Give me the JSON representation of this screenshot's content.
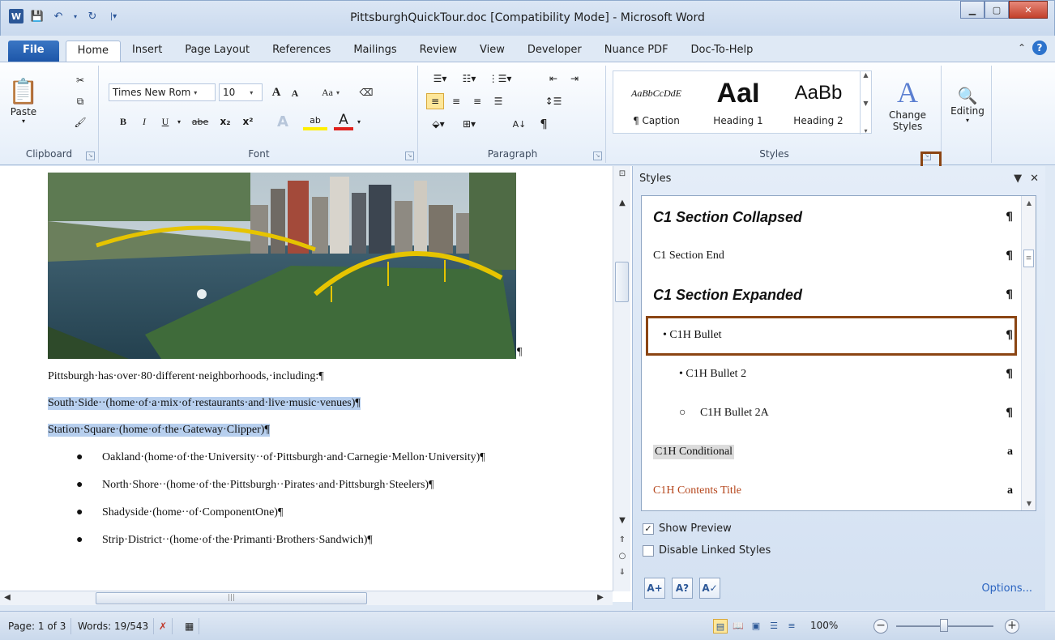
{
  "window": {
    "title": "PittsburghQuickTour.doc [Compatibility Mode] - Microsoft Word",
    "app_icon": "W",
    "controls": [
      "minimize",
      "maximize",
      "close"
    ]
  },
  "tabs": [
    "File",
    "Home",
    "Insert",
    "Page Layout",
    "References",
    "Mailings",
    "Review",
    "View",
    "Developer",
    "Nuance PDF",
    "Doc-To-Help"
  ],
  "active_tab": "Home",
  "ribbon": {
    "clipboard": {
      "label": "Clipboard",
      "paste_label": "Paste"
    },
    "font": {
      "label": "Font",
      "font_name": "Times New Rom",
      "font_size": "10",
      "aa_label": "Aa",
      "bold": "B",
      "italic": "I",
      "underline": "U",
      "strike": "abe",
      "subscript": "x₂",
      "superscript": "x²",
      "grow": "A",
      "shrink": "A",
      "highlight": "ab",
      "fontcolor": "A",
      "effects": "A"
    },
    "paragraph": {
      "label": "Paragraph",
      "pilcrow": "¶",
      "sort": "A↓"
    },
    "styles": {
      "label": "Styles",
      "gallery": [
        {
          "preview": "AaBbCcDdE",
          "name": "¶ Caption"
        },
        {
          "preview": "AaI",
          "name": "Heading 1"
        },
        {
          "preview": "AaBb",
          "name": "Heading 2"
        }
      ],
      "change_styles_line1": "Change",
      "change_styles_line2": "Styles"
    },
    "editing": {
      "label": "Editing"
    }
  },
  "document": {
    "intro": "Pittsburgh·has·over·80·different·neighborhoods,·including:¶",
    "selected_lines": [
      "South·Side··(home·of·a·mix·of·restaurants·and·live·music·venues)¶",
      "Station·Square·(home·of·the·Gateway·Clipper)¶"
    ],
    "bullets": [
      "Oakland·(home·of·the·University··of·Pittsburgh·and·Carnegie·Mellon·University)¶",
      "North·Shore··(home·of·the·Pittsburgh··Pirates·and·Pittsburgh·Steelers)¶",
      "Shadyside·(home··of·ComponentOne)¶",
      "Strip·District··(home·of·the·Primanti·Brothers·Sandwich)¶"
    ],
    "image_pilcrow": "¶"
  },
  "styles_pane": {
    "title": "Styles",
    "items": [
      {
        "name": "C1 Section Collapsed",
        "mark": "¶",
        "kind": "heading"
      },
      {
        "name": "C1 Section End",
        "mark": "¶",
        "kind": "normal"
      },
      {
        "name": "C1 Section Expanded",
        "mark": "¶",
        "kind": "heading"
      },
      {
        "name": "• C1H Bullet",
        "mark": "¶",
        "kind": "normal"
      },
      {
        "name": "• C1H Bullet 2",
        "mark": "¶",
        "kind": "normal"
      },
      {
        "name": "○     C1H Bullet 2A",
        "mark": "¶",
        "kind": "normal"
      },
      {
        "name": "C1H Conditional",
        "mark": "a",
        "kind": "char"
      },
      {
        "name": "C1H Contents Title",
        "mark": "a",
        "kind": "contents"
      }
    ],
    "show_preview": "Show Preview",
    "disable_linked": "Disable Linked Styles",
    "options": "Options..."
  },
  "status": {
    "page": "Page: 1 of 3",
    "words": "Words: 19/543",
    "zoom": "100%"
  },
  "colors": {
    "highlight_border": "#8b4513",
    "selection": "#b7cfee",
    "contents_title": "#b5461c"
  }
}
